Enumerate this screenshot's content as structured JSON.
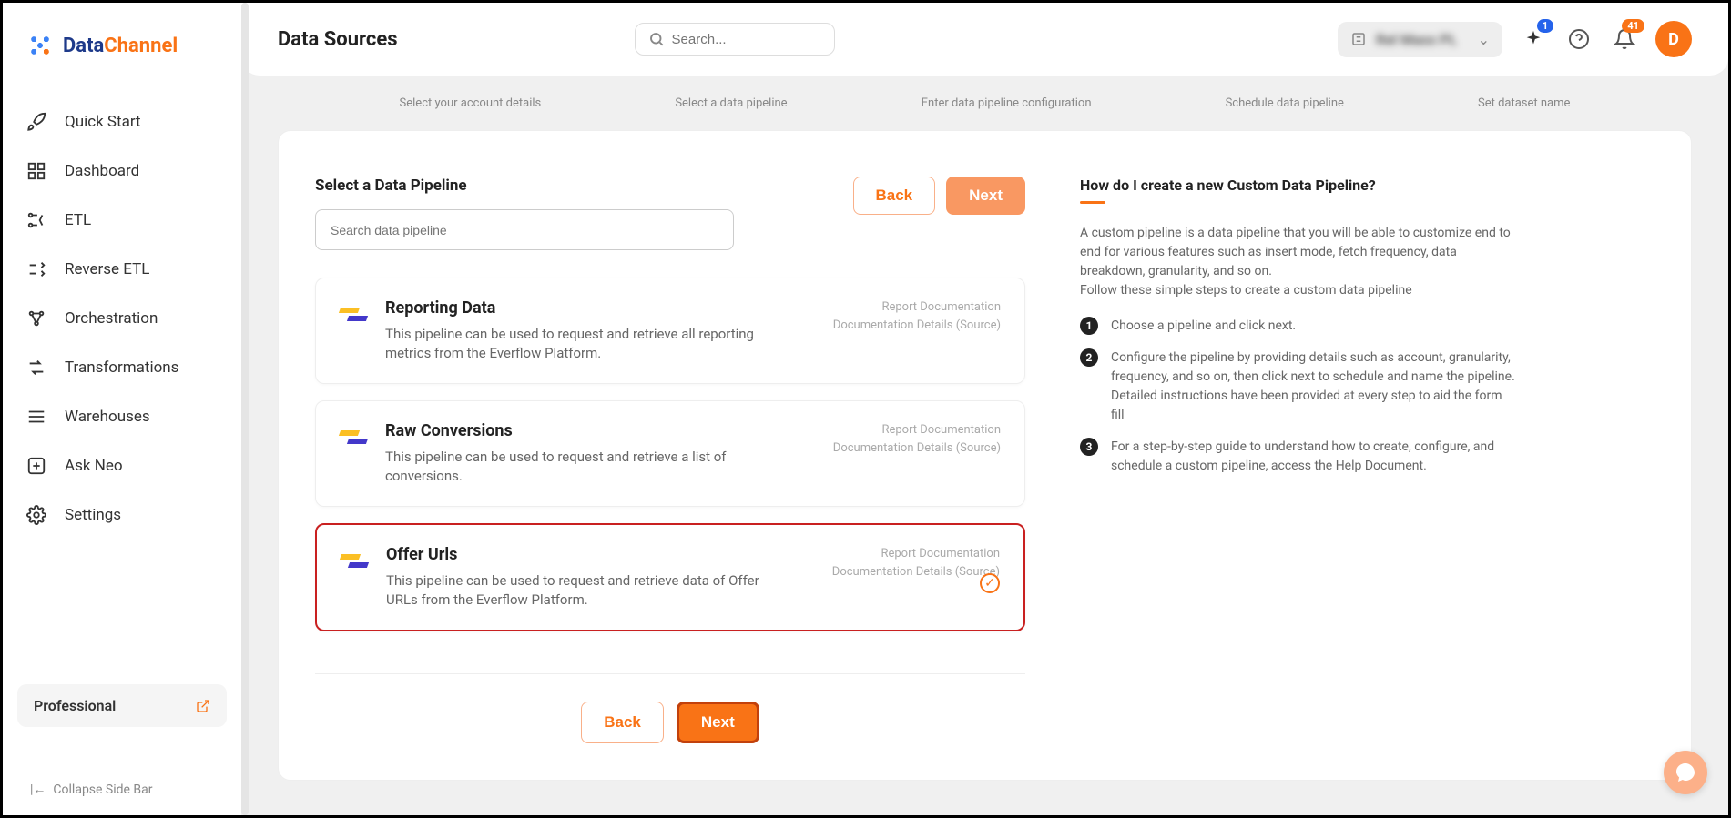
{
  "logo": {
    "part1": "Data",
    "part2": "Channel"
  },
  "sidebar": {
    "items": [
      {
        "label": "Quick Start"
      },
      {
        "label": "Dashboard"
      },
      {
        "label": "ETL"
      },
      {
        "label": "Reverse ETL"
      },
      {
        "label": "Orchestration"
      },
      {
        "label": "Transformations"
      },
      {
        "label": "Warehouses"
      },
      {
        "label": "Ask Neo"
      },
      {
        "label": "Settings"
      }
    ],
    "plan": "Professional",
    "collapse": "Collapse Side Bar"
  },
  "header": {
    "title": "Data Sources",
    "search_placeholder": "Search...",
    "sparkle_badge": "1",
    "bell_badge": "41",
    "avatar_letter": "D"
  },
  "steps": [
    "Select your account details",
    "Select a data pipeline",
    "Enter data pipeline configuration",
    "Schedule data pipeline",
    "Set dataset name"
  ],
  "main": {
    "section_title": "Select a Data Pipeline",
    "search_placeholder": "Search data pipeline",
    "back_label": "Back",
    "next_label": "Next",
    "link_doc": "Report Documentation",
    "link_details": "Documentation Details (Source)",
    "pipelines": [
      {
        "title": "Reporting Data",
        "desc": "This pipeline can be used to request and retrieve all reporting metrics from the Everflow Platform.",
        "selected": false
      },
      {
        "title": "Raw Conversions",
        "desc": "This pipeline can be used to request and retrieve a list of conversions.",
        "selected": false
      },
      {
        "title": "Offer Urls",
        "desc": "This pipeline can be used to request and retrieve data of Offer URLs from the Everflow Platform.",
        "selected": true
      }
    ]
  },
  "help": {
    "title": "How do I create a new Custom Data Pipeline?",
    "intro1": "A custom pipeline is a data pipeline that you will be able to customize end to end for various features such as insert mode, fetch frequency, data breakdown, granularity, and so on.",
    "intro2": "Follow these simple steps to create a custom data pipeline",
    "steps": [
      "Choose a pipeline and click next.",
      "Configure the pipeline by providing details such as account, granularity, frequency, and so on, then click next to schedule and name the pipeline. Detailed instructions have been provided at every step to aid the form fill",
      "For a step-by-step guide to understand how to create, configure, and schedule a custom pipeline, access the Help Document."
    ]
  }
}
